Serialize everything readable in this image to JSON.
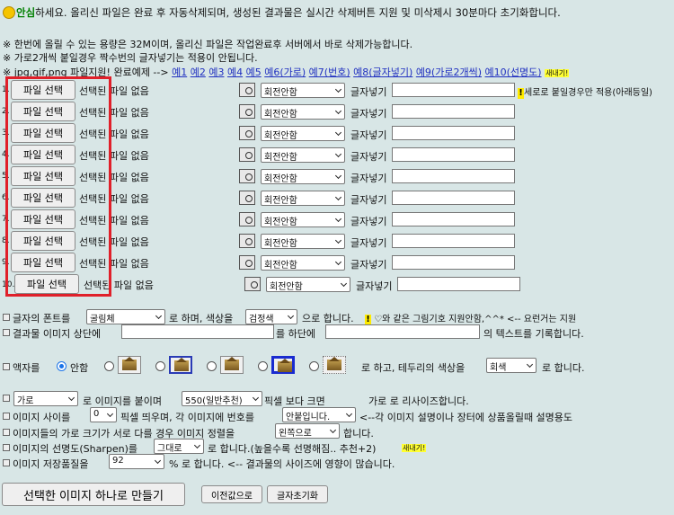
{
  "header": {
    "greet_strong": "안심",
    "greet_rest": "하세요. 올리신 파일은 완료 후 자동삭제되며, 생성된 결과물은 실시간 삭제버튼 지원 및 미삭제시 30분마다 초기화합니다.",
    "note1": "※ 한번에 올릴 수 있는 용량은 32M이며, 올리신 파일은 작업완료후 서버에서 바로 삭제가능합니다.",
    "note2": "※ 가로2개씩 붙일경우 짝수번의 글자넣기는 적용이 안됩니다.",
    "note3_prefix": "※ jpg,gif,png 파일지원! 완료예제 -->",
    "examples": [
      "예1",
      "예2",
      "예3",
      "예4",
      "예5",
      "예6(가로)",
      "예7(번호)",
      "예8(글자넣기)",
      "예9(가로2개씩)",
      "예10(선명도)"
    ],
    "new_badge": "새내기!"
  },
  "rows": {
    "file_btn": "파일 선택",
    "no_file": "선택된 파일 없음",
    "rotate": "회전안함",
    "text_label": "글자넣기",
    "vertical_note": "세로로 붙일경우만 적용(아래등일)",
    "nums": [
      "1.",
      "2.",
      "3.",
      "4.",
      "5.",
      "6.",
      "7.",
      "8.",
      "9.",
      "10."
    ]
  },
  "font_line": {
    "prefix": "글자의 폰트를",
    "font": "굴림체",
    "middle": "로 하며, 색상을",
    "color": "검정색",
    "suffix": "으로 합니다.",
    "note": "♡와 같은 그림기호 지원안함,^^* <-- 요런거는 지원"
  },
  "caption_line": {
    "prefix": "결과물 이미지 상단에",
    "middle": "를 하단에",
    "suffix": "의 텍스트를 기록합니다."
  },
  "frame_line": {
    "prefix": "액자를",
    "none": "안함",
    "middle": "로 하고, 테두리의 색상을",
    "border_color": "회색",
    "suffix": "로 합니다."
  },
  "options": {
    "l1_dir": "가로",
    "l1_a": "로 이미지를 붙이며",
    "l1_px": "550(일반추천)",
    "l1_b": "픽셀 보다 크면",
    "l1_c": "가로 로 리사이즈합니다.",
    "l2_a": "이미지 사이를",
    "l2_gap": "0",
    "l2_b": "픽셀 띄우며, 각 이미지에 번호를",
    "l2_num": "안붙입니다.",
    "l2_c": "<--각 이미지 설명이나 장터에 상품올릴때 설명용도",
    "l3_a": "이미지들의 가로 크기가 서로 다를 경우 이미지 정렬을",
    "l3_align": "왼쪽으로",
    "l3_b": "합니다.",
    "l4_a": "이미지의 선명도(Sharpen)를",
    "l4_sharp": "그대로",
    "l4_b": "로 합니다.(높을수록 선명해짐.. 추천+2)",
    "l5_a": "이미지 저장품질을",
    "l5_q": "92",
    "l5_b": "% 로 합니다. <-- 결과물의 사이즈에 영향이 많습니다."
  },
  "actions": {
    "make": "선택한 이미지 하나로 만들기",
    "prev": "이전값으로",
    "reset": "글자초기화"
  }
}
